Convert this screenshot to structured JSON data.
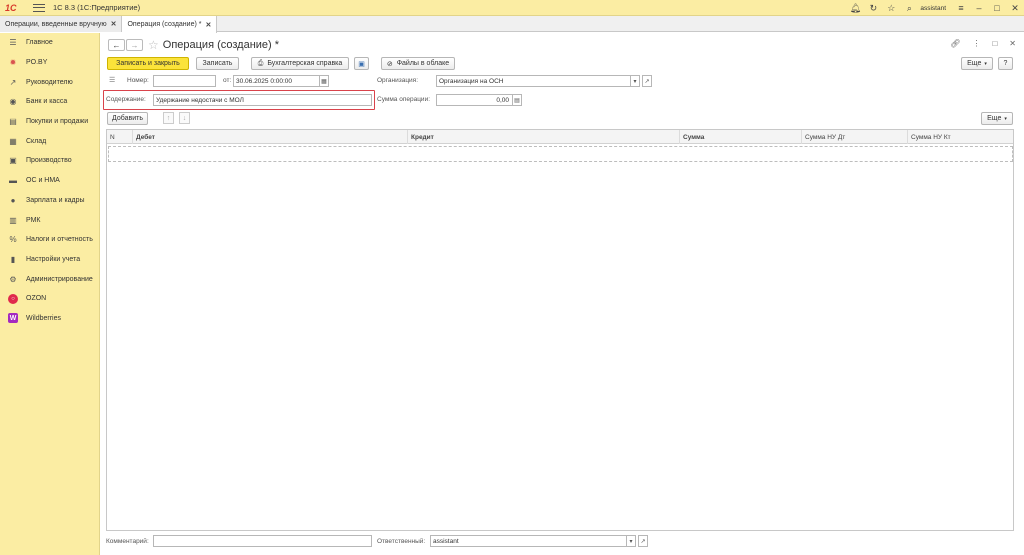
{
  "titlebar": {
    "logo": "1С",
    "app_title": "1С 8.3  (1С:Предприятие)",
    "user": "assistant",
    "icons": [
      "bell-icon",
      "history-icon",
      "star-icon",
      "search-icon",
      "menu-icon",
      "minimize-icon",
      "restore-icon",
      "close-icon"
    ]
  },
  "tabs": [
    {
      "label": "Операции, введенные вручную",
      "active": false
    },
    {
      "label": "Операция (создание) *",
      "active": true
    }
  ],
  "sidebar": {
    "items": [
      {
        "label": "Главное",
        "icon": "list-icon"
      },
      {
        "label": "PO.BY",
        "icon": "sun-icon"
      },
      {
        "label": "Руководителю",
        "icon": "trend-icon"
      },
      {
        "label": "Банк и касса",
        "icon": "bank-icon"
      },
      {
        "label": "Покупки и продажи",
        "icon": "cart-icon"
      },
      {
        "label": "Склад",
        "icon": "warehouse-icon"
      },
      {
        "label": "Производство",
        "icon": "factory-icon"
      },
      {
        "label": "ОС и НМА",
        "icon": "truck-icon"
      },
      {
        "label": "Зарплата и кадры",
        "icon": "person-icon"
      },
      {
        "label": "РМК",
        "icon": "register-icon"
      },
      {
        "label": "Налоги и отчетность",
        "icon": "percent-icon"
      },
      {
        "label": "Настройки учета",
        "icon": "book-icon"
      },
      {
        "label": "Администрирование",
        "icon": "gear-icon"
      },
      {
        "label": "OZON",
        "icon": "ozon-icon"
      },
      {
        "label": "Wildberries",
        "icon": "wildberries-icon"
      }
    ]
  },
  "form": {
    "title": "Операция (создание) *",
    "toolbar": {
      "save_close": "Записать и закрыть",
      "save": "Записать",
      "accounting_ref": "Бухгалтерская справка",
      "cloud_files": "Файлы в облаке",
      "more": "Еще"
    },
    "fields": {
      "number_label": "Номер:",
      "number_value": "",
      "date_label": "от:",
      "date_value": "30.06.2025  0:00:00",
      "org_label": "Организация:",
      "org_value": "Организация на ОСН",
      "content_label": "Содержание:",
      "content_value": "Удержание недостачи с МОЛ",
      "amount_label": "Сумма операции:",
      "amount_value": "0,00",
      "comment_label": "Комментарий:",
      "comment_value": "",
      "responsible_label": "Ответственный:",
      "responsible_value": "assistant"
    },
    "table_toolbar": {
      "add": "Добавить",
      "more": "Еще"
    },
    "table": {
      "columns": [
        "N",
        "Дебет",
        "Кредит",
        "Сумма",
        "Сумма НУ Дт",
        "Сумма НУ Кт"
      ],
      "rows": []
    }
  }
}
